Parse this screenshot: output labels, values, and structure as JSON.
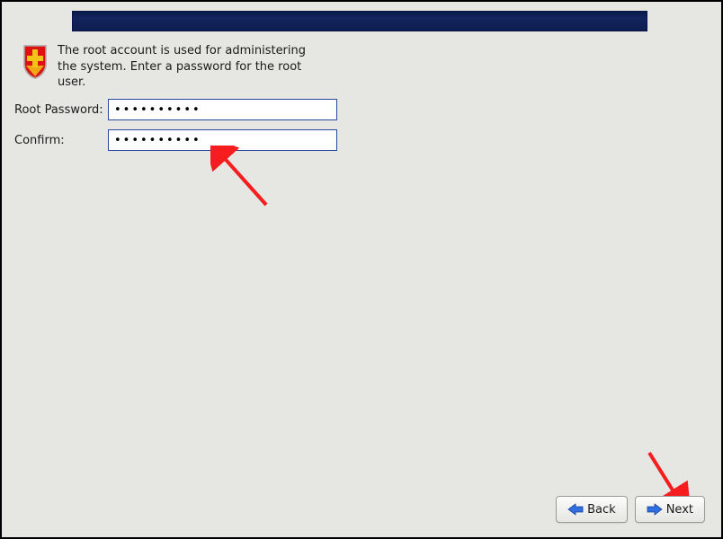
{
  "intro": {
    "text": "The root account is used for administering the system.  Enter a password for the root user."
  },
  "form": {
    "password_label": "Root Password:",
    "confirm_label": "Confirm:",
    "password_value": "••••••••••",
    "confirm_value": "••••••••••"
  },
  "buttons": {
    "back_label": "Back",
    "next_label": "Next"
  },
  "colors": {
    "header_gradient_top": "#0a1a4a",
    "header_gradient_bottom": "#0f1d4e",
    "annotation_arrow": "#f51d1d"
  }
}
